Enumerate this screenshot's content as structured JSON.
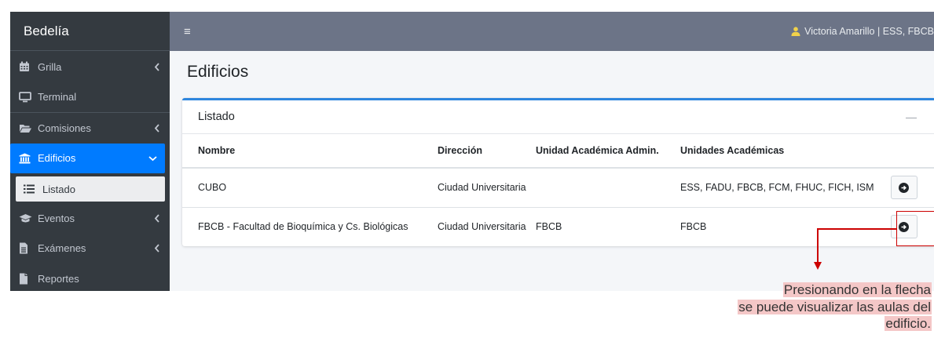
{
  "sidebar": {
    "brand": "Bedelía",
    "items": [
      {
        "label": "Grilla",
        "icon": "calendar-icon",
        "chevron": "left"
      },
      {
        "label": "Terminal",
        "icon": "monitor-icon",
        "chevron": ""
      },
      {
        "label": "Comisiones",
        "icon": "folder-open-icon",
        "chevron": "left"
      },
      {
        "label": "Edificios",
        "icon": "institution-icon",
        "chevron": "down",
        "active": true
      },
      {
        "label": "Listado",
        "icon": "list-icon",
        "sub": true
      },
      {
        "label": "Eventos",
        "icon": "graduation-cap-icon",
        "chevron": "left"
      },
      {
        "label": "Exámenes",
        "icon": "file-text-icon",
        "chevron": "left"
      },
      {
        "label": "Reportes",
        "icon": "file-icon",
        "chevron": ""
      }
    ]
  },
  "topbar": {
    "menu_icon": "≡",
    "user": "Victoria Amarillo | ESS, FBCB"
  },
  "page": {
    "title": "Edificios",
    "card": {
      "title": "Listado",
      "collapse_icon": "—",
      "columns": [
        "Nombre",
        "Dirección",
        "Unidad Académica Admin.",
        "Unidades Académicas"
      ],
      "rows": [
        {
          "nombre": "CUBO",
          "direccion": "Ciudad Universitaria",
          "ua_admin": "",
          "uas": "ESS, FADU, FBCB, FCM, FHUC, FICH, ISM"
        },
        {
          "nombre": "FBCB - Facultad de Bioquímica y Cs. Biológicas",
          "direccion": "Ciudad Universitaria",
          "ua_admin": "FBCB",
          "uas": "FBCB"
        }
      ]
    }
  },
  "annotation": {
    "lines": [
      "Presionando en la flecha",
      "se puede visualizar las aulas del",
      "edificio."
    ],
    "color": "#cc0000",
    "highlight": "#f4c7c7"
  },
  "colors": {
    "sidebar_bg": "#343a40",
    "topbar_bg": "#6c7487",
    "active": "#007bff",
    "card_accent": "#2e86de"
  }
}
